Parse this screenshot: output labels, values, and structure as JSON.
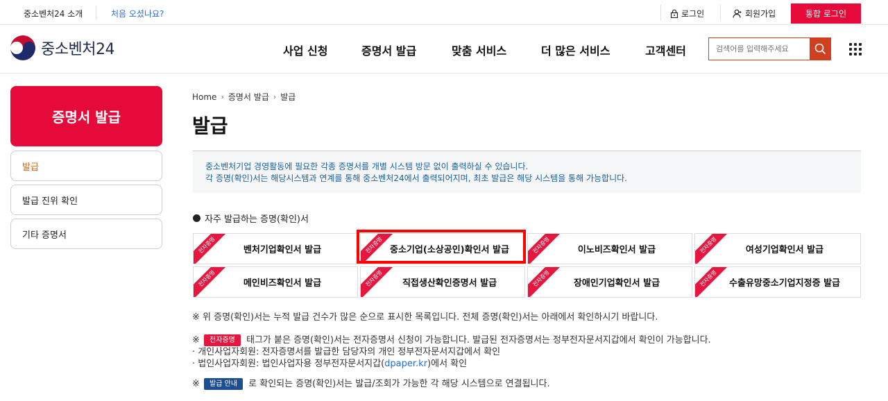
{
  "topbar": {
    "about": "중소벤처24 소개",
    "first_visit": "처음 오셨나요?",
    "login": "로그인",
    "signup": "회원가입",
    "sso_login": "통합 로그인"
  },
  "header": {
    "logo_text": "중소벤처24",
    "nav": [
      "사업 신청",
      "증명서 발급",
      "맞춤 서비스",
      "더 많은 서비스",
      "고객센터"
    ],
    "search_placeholder": "검색어를 입력해주세요"
  },
  "sidebar": {
    "title": "증명서 발급",
    "items": [
      {
        "label": "발급",
        "active": true
      },
      {
        "label": "발급 진위 확인",
        "active": false
      },
      {
        "label": "기타 증명서",
        "active": false
      }
    ]
  },
  "breadcrumb": [
    "Home",
    "증명서 발급",
    "발급"
  ],
  "page_title": "발급",
  "info": {
    "line1": "중소벤처기업 경영활동에 필요한 각종 증명서를 개별 시스템 방문 없이 출력하실 수 있습니다.",
    "line2": "각 증명(확인)서는 해당시스템과 연계를 통해 중소벤처24에서 출력되어지며, 최초 발급은 해당 시스템을 통해 가능합니다."
  },
  "frequent": {
    "heading": "자주 발급하는 증명(확인)서",
    "ribbon": "전자증명",
    "cards": [
      "벤처기업확인서 발급",
      "중소기업(소상공인)확인서 발급",
      "이노비즈확인서 발급",
      "여성기업확인서 발급",
      "메인비즈확인서 발급",
      "직접생산확인증명서 발급",
      "장애인기업확인서 발급",
      "수출유망중소기업지정증 발급"
    ]
  },
  "notes": {
    "n1": "※ 위 증명(확인)서는 누적 발급 건수가 많은 순으로 표시한 목록입니다. 전체 증명(확인)서는 아래에서 확인하시기 바랍니다.",
    "n2_mark": "※",
    "n2_tag": "전자증명",
    "n2_text": "태그가 붙은 증명(확인)서는 전자증명서 신청이 가능합니다. 발급된 전자증명서는 정부전자문서지갑에서 확인이 가능합니다.",
    "n2_sub1": "· 개인사업자회원: 전자증명서를 발급한 담당자의 개인 정부전자문서지갑에서 확인",
    "n2_sub2_pre": "· 법인사업자회원: 법인사업자용 정부전자문서지갑(",
    "n2_sub2_link": "dpaper.kr",
    "n2_sub2_post": ")에서 확인",
    "n3_mark": "※",
    "n3_tag": "발급 안내",
    "n3_text": "로 확인되는 증명(확인)서는 발급/조회가 가능한 각 해당 시스템으로 연결됩니다."
  }
}
